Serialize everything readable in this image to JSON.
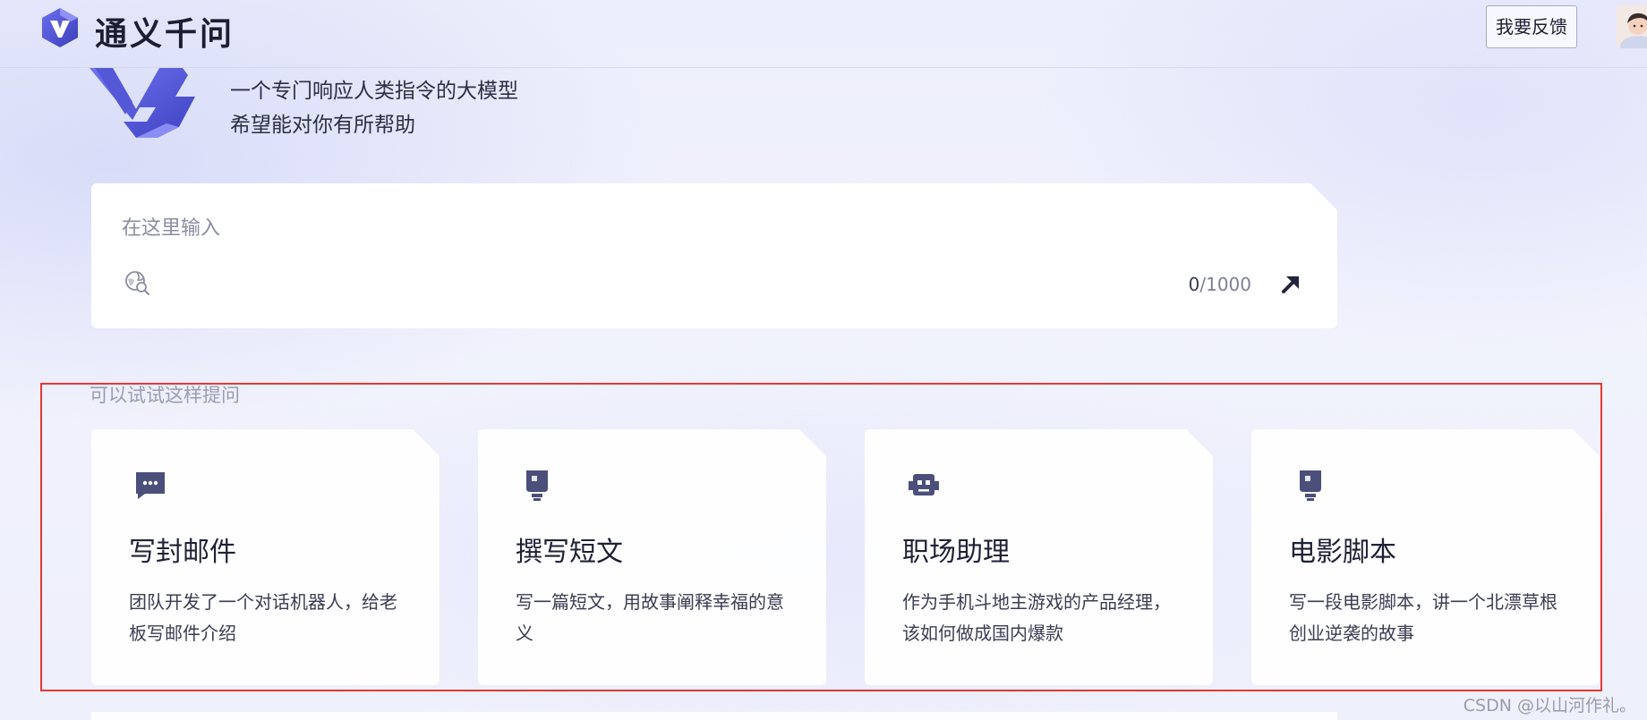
{
  "header": {
    "brand_name": "通义千问",
    "feedback_label": "我要反馈"
  },
  "hero": {
    "line1": "一个专门响应人类指令的大模型",
    "line2": "希望能对你有所帮助"
  },
  "input": {
    "placeholder": "在这里输入",
    "current_count": "0",
    "max_count": "/1000"
  },
  "suggestions": {
    "title": "可以试试这样提问",
    "cards": [
      {
        "icon": "chat-bubble-icon",
        "title": "写封邮件",
        "desc": "团队开发了一个对话机器人，给老板写邮件介绍"
      },
      {
        "icon": "lightbulb-icon",
        "title": "撰写短文",
        "desc": "写一篇短文，用故事阐释幸福的意义"
      },
      {
        "icon": "robot-icon",
        "title": "职场助理",
        "desc": "作为手机斗地主游戏的产品经理，该如何做成国内爆款"
      },
      {
        "icon": "lightbulb-icon",
        "title": "电影脚本",
        "desc": "写一段电影脚本，讲一个北漂草根创业逆袭的故事"
      }
    ]
  },
  "watermark": "CSDN @以山河作礼。",
  "colors": {
    "brand_accent": "#5b5fd8",
    "icon_color": "#4b4f7a",
    "highlight_border": "#e53935"
  }
}
